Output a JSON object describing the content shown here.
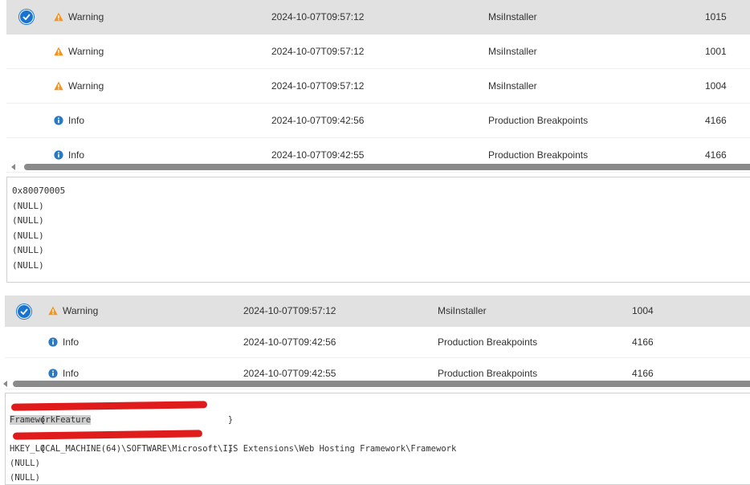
{
  "panel1": {
    "rows": [
      {
        "level": "Warning",
        "icon": "warning-icon",
        "datetime": "2024-10-07T09:57:12",
        "source": "MsiInstaller",
        "event_id": "1015",
        "selected": true
      },
      {
        "level": "Warning",
        "icon": "warning-icon",
        "datetime": "2024-10-07T09:57:12",
        "source": "MsiInstaller",
        "event_id": "1001",
        "selected": false
      },
      {
        "level": "Warning",
        "icon": "warning-icon",
        "datetime": "2024-10-07T09:57:12",
        "source": "MsiInstaller",
        "event_id": "1004",
        "selected": false
      },
      {
        "level": "Info",
        "icon": "info-icon",
        "datetime": "2024-10-07T09:42:56",
        "source": "Production Breakpoints",
        "event_id": "4166",
        "selected": false
      },
      {
        "level": "Info",
        "icon": "info-icon",
        "datetime": "2024-10-07T09:42:55",
        "source": "Production Breakpoints",
        "event_id": "4166",
        "selected": false
      }
    ],
    "details_lines": [
      "0x80070005",
      "(NULL)",
      "(NULL)",
      "(NULL)",
      "(NULL)",
      "(NULL)"
    ]
  },
  "panel2": {
    "rows": [
      {
        "level": "Warning",
        "icon": "warning-icon",
        "datetime": "2024-10-07T09:57:12",
        "source": "MsiInstaller",
        "event_id": "1004",
        "selected": true
      },
      {
        "level": "Info",
        "icon": "info-icon",
        "datetime": "2024-10-07T09:42:56",
        "source": "Production Breakpoints",
        "event_id": "4166",
        "selected": false
      },
      {
        "level": "Info",
        "icon": "info-icon",
        "datetime": "2024-10-07T09:42:55",
        "source": "Production Breakpoints",
        "event_id": "4166",
        "selected": false
      }
    ],
    "details_lines": [
      "{                                    }",
      "FrameworkFeature",
      "{                                    }",
      "HKEY_LOCAL_MACHINE(64)\\SOFTWARE\\Microsoft\\IIS Extensions\\Web Hosting Framework\\Framework",
      "(NULL)",
      "(NULL)"
    ]
  },
  "colors": {
    "selected_row": "#e1e1e1",
    "check_blue": "#1a73d1",
    "warning_orange": "#f7941d",
    "info_blue": "#2b79c2",
    "redaction_red": "#e01b1b"
  }
}
